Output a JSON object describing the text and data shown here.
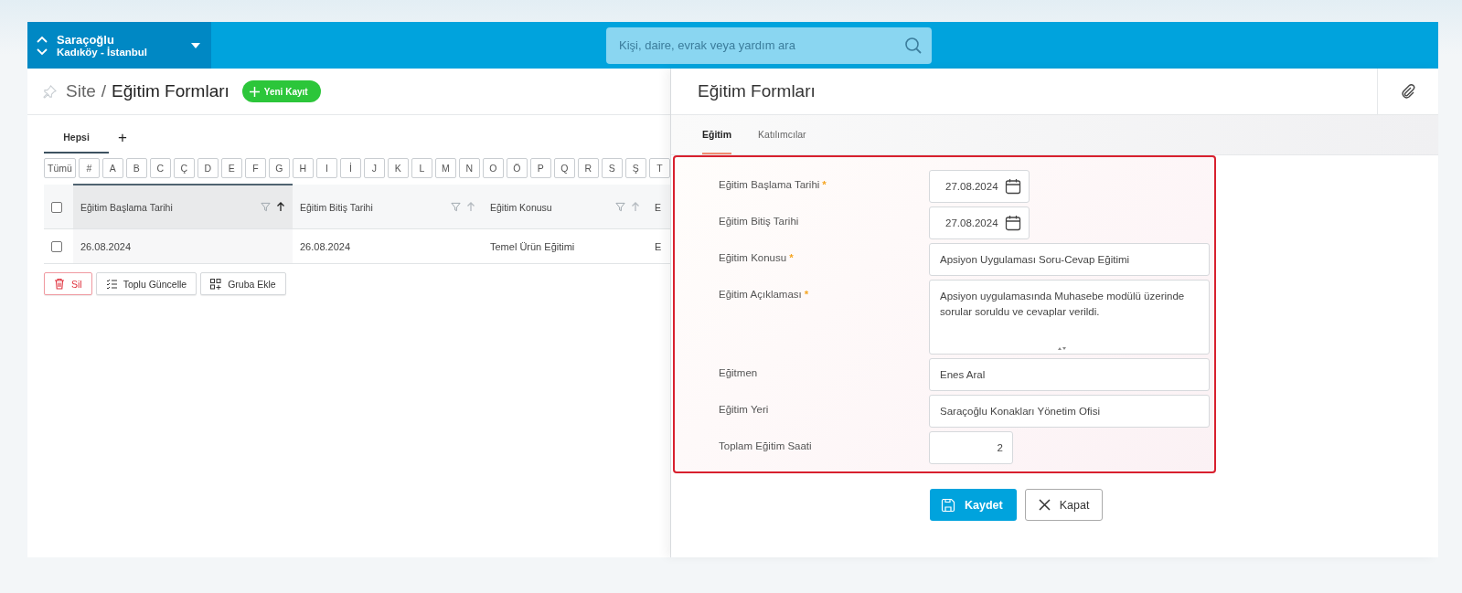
{
  "topbar": {
    "site_name": "Saraçoğlu",
    "site_location": "Kadıköy - İstanbul",
    "search": {
      "placeholder": "Kişi, daire, evrak veya yardım ara"
    }
  },
  "list": {
    "breadcrumb_root": "Site",
    "breadcrumb_separator": "/",
    "title": "Eğitim Formları",
    "new_button": "Yeni Kayıt",
    "views": [
      {
        "label": "Hepsi",
        "selected": true
      }
    ],
    "add_view": "+",
    "letters": [
      "Tümü",
      "#",
      "A",
      "B",
      "C",
      "Ç",
      "D",
      "E",
      "F",
      "G",
      "H",
      "I",
      "İ",
      "J",
      "K",
      "L",
      "M",
      "N",
      "O",
      "Ö",
      "P",
      "Q",
      "R",
      "S",
      "Ş",
      "T"
    ],
    "table": {
      "select_all_checked": false,
      "columns": [
        {
          "label": "Eğitim Başlama Tarihi",
          "sorted": true
        },
        {
          "label": "Eğitim Bitiş Tarihi",
          "sorted": false
        },
        {
          "label": "Eğitim Konusu",
          "sorted": false
        },
        {
          "label": "E",
          "sorted": false
        }
      ],
      "rows": [
        {
          "checked": false,
          "cells": [
            "26.08.2024",
            "26.08.2024",
            "Temel Ürün Eğitimi",
            "E"
          ]
        }
      ]
    },
    "actions": [
      {
        "kind": "delete",
        "label": "Sil"
      },
      {
        "kind": "bulk",
        "label": "Toplu Güncelle"
      },
      {
        "kind": "group",
        "label": "Gruba Ekle"
      }
    ]
  },
  "form": {
    "title": "Eğitim Formları",
    "tabs": [
      {
        "label": "Eğitim",
        "selected": true
      },
      {
        "label": "Katılımcılar",
        "selected": false
      }
    ],
    "required_marker": "*",
    "fields": [
      {
        "kind": "date",
        "label": "Eğitim Başlama Tarihi",
        "required": true,
        "value": "27.08.2024"
      },
      {
        "kind": "date",
        "label": "Eğitim Bitiş Tarihi",
        "required": false,
        "value": "27.08.2024"
      },
      {
        "kind": "text",
        "label": "Eğitim Konusu",
        "required": true,
        "value": "Apsiyon Uygulaması Soru-Cevap Eğitimi"
      },
      {
        "kind": "textarea",
        "label": "Eğitim Açıklaması",
        "required": true,
        "value": "Apsiyon uygulamasında Muhasebe modülü üzerinde sorular soruldu ve cevaplar verildi."
      },
      {
        "kind": "text",
        "label": "Eğitmen",
        "required": false,
        "value": "Enes Aral"
      },
      {
        "kind": "text",
        "label": "Eğitim Yeri",
        "required": false,
        "value": "Saraçoğlu Konakları Yönetim Ofisi"
      },
      {
        "kind": "number",
        "label": "Toplam Eğitim Saati",
        "required": false,
        "value": "2"
      }
    ],
    "buttons": [
      {
        "kind": "save",
        "label": "Kaydet"
      },
      {
        "kind": "close",
        "label": "Kapat"
      }
    ]
  }
}
